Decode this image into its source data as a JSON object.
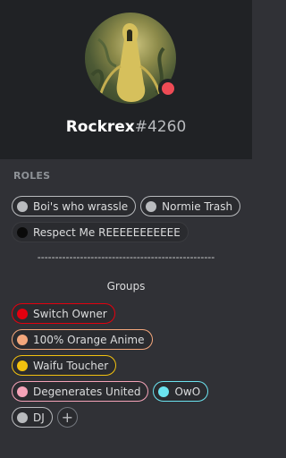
{
  "profile": {
    "username": "Rockrex",
    "discriminator": "#4260",
    "status_color": "#ee4b55"
  },
  "roles_section": {
    "label": "ROLES",
    "roles": [
      {
        "label": "Boi's who wrassle",
        "color": "#b9bbbe"
      },
      {
        "label": "Normie Trash",
        "color": "#b9bbbe"
      },
      {
        "label": "Respect Me REEEEEEEEEEE",
        "color": "#0a0a0a",
        "border": "#3a3b3f"
      }
    ]
  },
  "divider_text": "--------------------------------------------------",
  "groups_section": {
    "title": "Groups",
    "roles": [
      {
        "label": "Switch Owner",
        "color": "#e3000f",
        "border": "#e3000f"
      },
      {
        "label": "100% Orange Anime",
        "color": "#f4a77c",
        "border": "#f4a77c"
      },
      {
        "label": "Waifu Toucher",
        "color": "#f2c10f",
        "border": "#f2c10f"
      },
      {
        "label": "Degenerates United",
        "color": "#f5a3b8",
        "border": "#f5a3b8"
      },
      {
        "label": "OwO",
        "color": "#6be3ef",
        "border": "#6be3ef"
      },
      {
        "label": "DJ",
        "color": "#b9bbbe",
        "border": "#b9bbbe"
      }
    ],
    "add_label": "+"
  }
}
